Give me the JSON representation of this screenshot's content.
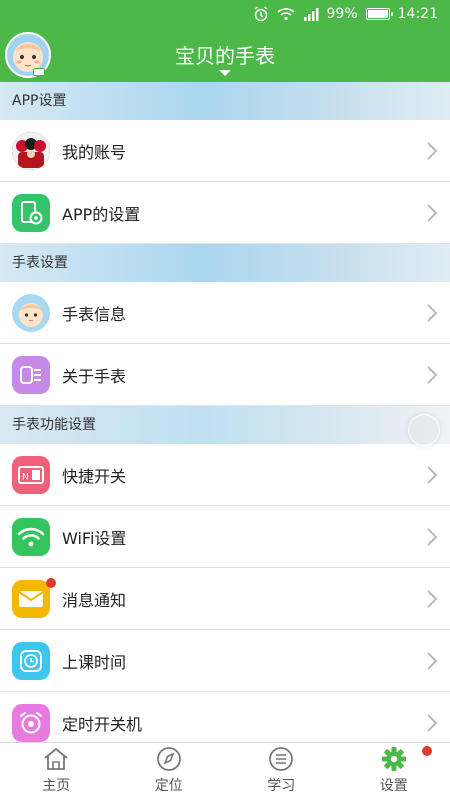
{
  "status_bar": {
    "battery": "99%",
    "time": "14:21"
  },
  "header": {
    "title": "宝贝的手表"
  },
  "sections": [
    {
      "title": "APP设置",
      "items": [
        {
          "label": "我的账号",
          "icon": "account-avatar-icon"
        },
        {
          "label": "APP的设置",
          "icon": "app-settings-icon"
        }
      ]
    },
    {
      "title": "手表设置",
      "items": [
        {
          "label": "手表信息",
          "icon": "watch-info-icon"
        },
        {
          "label": "关于手表",
          "icon": "about-watch-icon"
        }
      ]
    },
    {
      "title": "手表功能设置",
      "items": [
        {
          "label": "快捷开关",
          "icon": "quick-switch-icon"
        },
        {
          "label": "WiFi设置",
          "icon": "wifi-icon"
        },
        {
          "label": "消息通知",
          "icon": "mail-icon"
        },
        {
          "label": "上课时间",
          "icon": "class-time-icon"
        },
        {
          "label": "定时开关机",
          "icon": "alarm-clock-icon"
        }
      ]
    }
  ],
  "bottom_nav": [
    {
      "label": "主页",
      "icon": "home-icon"
    },
    {
      "label": "定位",
      "icon": "compass-icon"
    },
    {
      "label": "学习",
      "icon": "study-icon"
    },
    {
      "label": "设置",
      "icon": "gear-icon",
      "active": true
    }
  ],
  "colors": {
    "brand_green": "#4cb848",
    "notification_dot": "#e03a2f"
  }
}
